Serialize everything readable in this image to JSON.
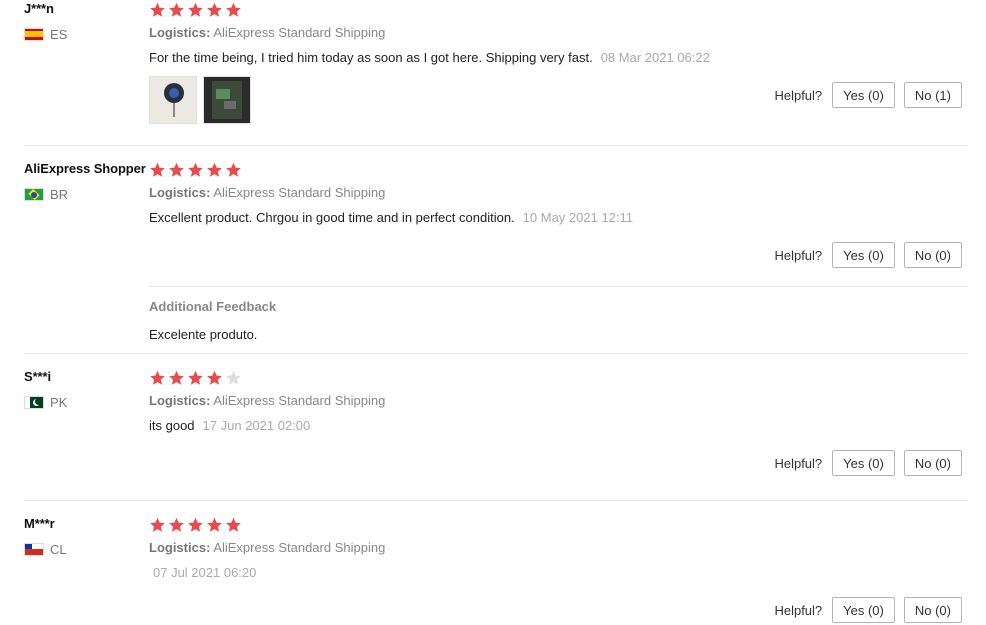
{
  "helpful_label": "Helpful?",
  "logistics_label": "Logistics:",
  "colors": {
    "star_filled": "#e84a4f",
    "star_empty": "#dddddd",
    "divider": "#e6e6e6"
  },
  "reviews": [
    {
      "user": "J***n",
      "country": "ES",
      "flag_icon": "spain-flag-icon",
      "rating": 5,
      "logistics": "AliExpress Standard Shipping",
      "text": "For the time being, I tried him today as soon as I got here. Shipping very fast.",
      "date": "08 Mar 2021 06:22",
      "yes": "Yes (0)",
      "no": "No (1)"
    },
    {
      "user": "AliExpress Shopper",
      "country": "BR",
      "flag_icon": "brazil-flag-icon",
      "rating": 5,
      "logistics": "AliExpress Standard Shipping",
      "text": "Excellent product. Chrgou in good time and in perfect condition.",
      "date": "10 May 2021 12:11",
      "yes": "Yes (0)",
      "no": "No (0)",
      "additional_feedback_title": "Additional Feedback",
      "additional_feedback_text": "Excelente produto."
    },
    {
      "user": "S***i",
      "country": "PK",
      "flag_icon": "pakistan-flag-icon",
      "rating": 4,
      "logistics": "AliExpress Standard Shipping",
      "text": "its good",
      "date": "17 Jun 2021 02:00",
      "yes": "Yes (0)",
      "no": "No (0)"
    },
    {
      "user": "M***r",
      "country": "CL",
      "flag_icon": "chile-flag-icon",
      "rating": 5,
      "logistics": "AliExpress Standard Shipping",
      "text": "",
      "date": "07 Jul 2021 06:20",
      "yes": "Yes (0)",
      "no": "No (0)"
    }
  ]
}
